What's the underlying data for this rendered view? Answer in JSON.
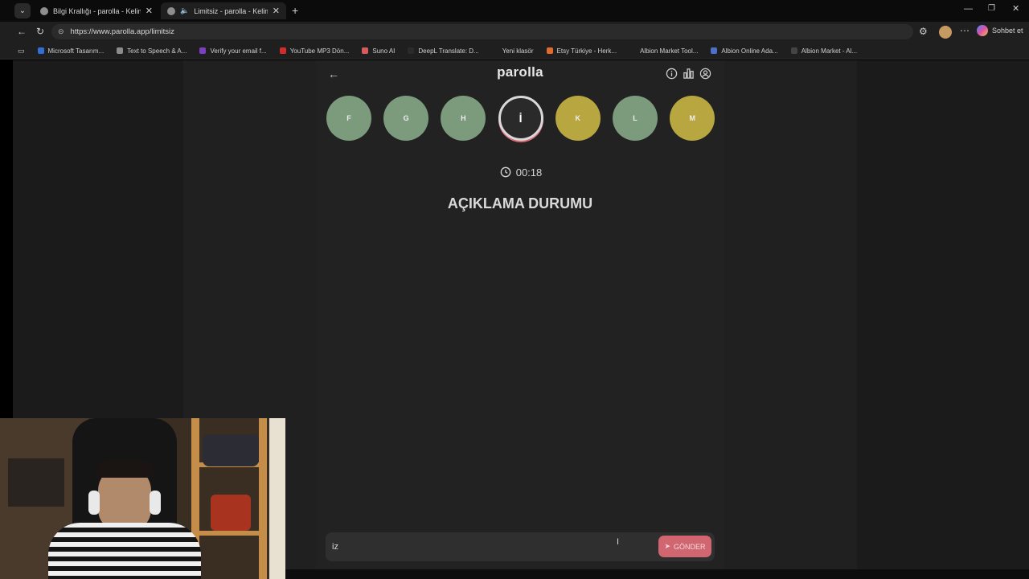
{
  "browser": {
    "tabs": [
      {
        "title": "Bilgi Krallığı - parolla - Kelime oyu",
        "active": false
      },
      {
        "title": "Limitsiz - parolla - Kelime oyu",
        "active": true
      }
    ],
    "url": "https://www.parolla.app/limitsiz",
    "profile_label": "Sohbet et",
    "bookmarks": [
      {
        "label": "Microsoft Tasarım...",
        "color": "#2f6fd6"
      },
      {
        "label": "Text to Speech & A...",
        "color": "#8b8b8b"
      },
      {
        "label": "Verify your email f...",
        "color": "#7b3fc4"
      },
      {
        "label": "YouTube MP3 Dön...",
        "color": "#d22b2b"
      },
      {
        "label": "Suno AI",
        "color": "#d85b5b"
      },
      {
        "label": "DeepL Translate: D...",
        "color": "#2b2b2b"
      },
      {
        "label": "Yeni klasör",
        "color": "#1f1f1f"
      },
      {
        "label": "Etsy Türkiye - Herk...",
        "color": "#e06b2d"
      },
      {
        "label": "Albion Market Tool...",
        "color": "#1f1f1f"
      },
      {
        "label": "Albion Online Ada...",
        "color": "#4d6fc7"
      },
      {
        "label": "Albion Market - Al...",
        "color": "#444444"
      }
    ]
  },
  "app": {
    "logo": "parolla",
    "letters": [
      {
        "char": "F",
        "state": "green"
      },
      {
        "char": "G",
        "state": "green"
      },
      {
        "char": "H",
        "state": "green"
      },
      {
        "char": "İ",
        "state": "current"
      },
      {
        "char": "K",
        "state": "yellow"
      },
      {
        "char": "L",
        "state": "green"
      },
      {
        "char": "M",
        "state": "yellow"
      }
    ],
    "timer": "00:18",
    "question": "AÇIKLAMA DURUMU",
    "answer_value": "iz",
    "send_label": "GÖNDER"
  }
}
